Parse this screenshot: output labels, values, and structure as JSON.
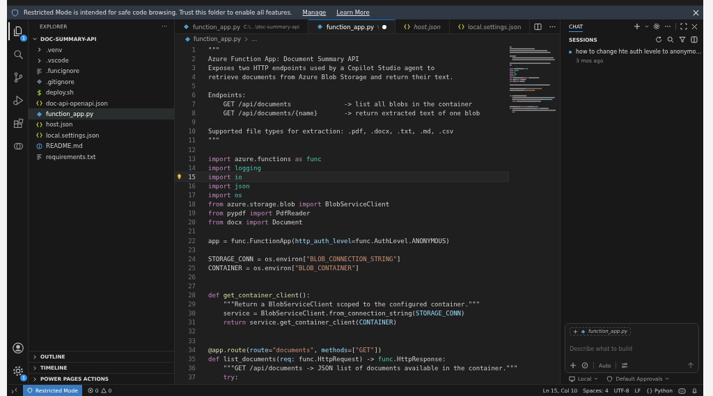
{
  "banner": {
    "message": "Restricted Mode is intended for safe code browsing. Trust this folder to enable all features.",
    "links": [
      "Manage",
      "Learn More"
    ]
  },
  "activity_bar": {
    "top": [
      {
        "kind": "files",
        "selected": true,
        "badge": "1"
      },
      {
        "kind": "search",
        "selected": false
      },
      {
        "kind": "source-control",
        "selected": false
      },
      {
        "kind": "run",
        "selected": false
      },
      {
        "kind": "extensions",
        "selected": false
      },
      {
        "kind": "copilot",
        "selected": false
      }
    ],
    "bottom": [
      {
        "kind": "account",
        "selected": false
      },
      {
        "kind": "settings",
        "selected": false,
        "badge": "1"
      }
    ]
  },
  "sidebar": {
    "title": "EXPLORER",
    "more": "···",
    "root": {
      "label": "DOC-SUMMARY-API",
      "expanded": true,
      "children": [
        {
          "label": ".venv",
          "kind": "folder",
          "expanded": false,
          "selected": false
        },
        {
          "label": ".vscode",
          "kind": "folder",
          "expanded": false,
          "selected": false
        },
        {
          "label": ".funcignore",
          "kind": "lines",
          "selected": false
        },
        {
          "label": ".gitignore",
          "kind": "git",
          "selected": false
        },
        {
          "label": "deploy.sh",
          "kind": "shell",
          "selected": false
        },
        {
          "label": "doc-api-openapi.json",
          "kind": "json",
          "selected": false
        },
        {
          "label": "function_app.py",
          "kind": "python",
          "selected": true
        },
        {
          "label": "host.json",
          "kind": "json",
          "selected": false
        },
        {
          "label": "local.settings.json",
          "kind": "json",
          "selected": false
        },
        {
          "label": "README.md",
          "kind": "info",
          "selected": false
        },
        {
          "label": "requirements.txt",
          "kind": "lines",
          "selected": false
        }
      ]
    },
    "sections": [
      {
        "label": "OUTLINE",
        "expanded": false
      },
      {
        "label": "TIMELINE",
        "expanded": false
      },
      {
        "label": "POWER PAGES ACTIONS",
        "expanded": false
      }
    ]
  },
  "tabs": [
    {
      "label": "function_app.py",
      "kind": "python",
      "description": "C:\\...\\doc-summary-api",
      "selected": false,
      "preview": false,
      "dirty": false
    },
    {
      "label": "function_app.py",
      "kind": "python",
      "description": "\\",
      "selected": true,
      "preview": false,
      "dirty": true
    },
    {
      "label": "host.json",
      "kind": "json",
      "selected": false,
      "preview": true,
      "dirty": false
    },
    {
      "label": "local.settings.json",
      "kind": "json",
      "selected": false,
      "preview": false,
      "dirty": false
    }
  ],
  "breadcrumb": [
    "function_app.py",
    "..."
  ],
  "code": [
    {
      "number": "1",
      "active": false,
      "tokens": [
        {
          "text": "\"\"\"",
          "kind": "doc"
        }
      ]
    },
    {
      "number": "2",
      "active": false,
      "tokens": [
        {
          "text": "Azure Function App: Document Summary API",
          "kind": "doc"
        }
      ]
    },
    {
      "number": "3",
      "active": false,
      "tokens": [
        {
          "text": "Exposes two HTTP endpoints used by a Copilot Studio agent to",
          "kind": "doc"
        }
      ]
    },
    {
      "number": "4",
      "active": false,
      "tokens": [
        {
          "text": "retrieve documents from Azure Blob Storage and return their text.",
          "kind": "doc"
        }
      ]
    },
    {
      "number": "5",
      "active": false
    },
    {
      "number": "6",
      "active": false,
      "tokens": [
        {
          "text": "Endpoints:",
          "kind": "doc"
        }
      ]
    },
    {
      "number": "7",
      "active": false,
      "tokens": [
        {
          "text": "    GET /api/documents              -> list all blobs in the container",
          "kind": "doc"
        }
      ]
    },
    {
      "number": "8",
      "active": false,
      "tokens": [
        {
          "text": "    GET /api/documents/{name}       -> return extracted text of one blob",
          "kind": "doc"
        }
      ]
    },
    {
      "number": "9",
      "active": false
    },
    {
      "number": "10",
      "active": false,
      "tokens": [
        {
          "text": "Supported file types for extraction: .pdf, .docx, .txt, .md, .csv",
          "kind": "doc"
        }
      ]
    },
    {
      "number": "11",
      "active": false,
      "tokens": [
        {
          "text": "\"\"\"",
          "kind": "doc"
        }
      ]
    },
    {
      "number": "12",
      "active": false
    },
    {
      "number": "13",
      "active": false,
      "tokens": [
        {
          "text": "import",
          "kind": "kw"
        },
        {
          "text": " azure.functions ",
          "kind": "op"
        },
        {
          "text": "as",
          "kind": "kw"
        },
        {
          "text": " func",
          "kind": "cls"
        }
      ]
    },
    {
      "number": "14",
      "active": false,
      "tokens": [
        {
          "text": "import",
          "kind": "kw"
        },
        {
          "text": " logging",
          "kind": "cls"
        }
      ]
    },
    {
      "number": "15",
      "active": true,
      "tokens": [
        {
          "text": "import",
          "kind": "kw"
        },
        {
          "text": " io",
          "kind": "cls"
        }
      ]
    },
    {
      "number": "16",
      "active": false,
      "tokens": [
        {
          "text": "import",
          "kind": "kw"
        },
        {
          "text": " json",
          "kind": "cls"
        }
      ]
    },
    {
      "number": "17",
      "active": false,
      "tokens": [
        {
          "text": "import",
          "kind": "kw"
        },
        {
          "text": " os",
          "kind": "cls"
        }
      ]
    },
    {
      "number": "18",
      "active": false,
      "tokens": [
        {
          "text": "from",
          "kind": "kw"
        },
        {
          "text": " azure.storage.blob ",
          "kind": "op"
        },
        {
          "text": "import",
          "kind": "kw"
        },
        {
          "text": " BlobServiceClient",
          "kind": "op"
        }
      ]
    },
    {
      "number": "19",
      "active": false,
      "tokens": [
        {
          "text": "from",
          "kind": "kw"
        },
        {
          "text": " pypdf ",
          "kind": "op"
        },
        {
          "text": "import",
          "kind": "kw"
        },
        {
          "text": " PdfReader",
          "kind": "op"
        }
      ]
    },
    {
      "number": "20",
      "active": false,
      "tokens": [
        {
          "text": "from",
          "kind": "kw"
        },
        {
          "text": " docx ",
          "kind": "op"
        },
        {
          "text": "import",
          "kind": "kw"
        },
        {
          "text": " Document",
          "kind": "op"
        }
      ]
    },
    {
      "number": "21",
      "active": false
    },
    {
      "number": "22",
      "active": false,
      "tokens": [
        {
          "text": "app = func.FunctionApp(",
          "kind": "op"
        },
        {
          "text": "http_auth_level",
          "kind": "var"
        },
        {
          "text": "=func.AuthLevel.ANONYMOUS)",
          "kind": "op"
        }
      ]
    },
    {
      "number": "23",
      "active": false
    },
    {
      "number": "24",
      "active": false,
      "tokens": [
        {
          "text": "STORAGE_CONN = os.environ[",
          "kind": "op"
        },
        {
          "text": "\"BLOB_CONNECTION_STRING\"",
          "kind": "str"
        },
        {
          "text": "]",
          "kind": "op"
        }
      ]
    },
    {
      "number": "25",
      "active": false,
      "tokens": [
        {
          "text": "CONTAINER = os.environ[",
          "kind": "op"
        },
        {
          "text": "\"BLOB_CONTAINER\"",
          "kind": "str"
        },
        {
          "text": "]",
          "kind": "op"
        }
      ]
    },
    {
      "number": "26",
      "active": false
    },
    {
      "number": "27",
      "active": false
    },
    {
      "number": "28",
      "active": false,
      "tokens": [
        {
          "text": "def",
          "kind": "kw"
        },
        {
          "text": " get_container_client",
          "kind": "fn"
        },
        {
          "text": "():",
          "kind": "op"
        }
      ]
    },
    {
      "number": "29",
      "active": false,
      "tokens": [
        {
          "text": "    \"\"\"Return a BlobServiceClient scoped to the configured container.\"\"\"",
          "kind": "doc"
        }
      ]
    },
    {
      "number": "30",
      "active": false,
      "tokens": [
        {
          "text": "    service = BlobServiceClient.from_connection_string(",
          "kind": "op"
        },
        {
          "text": "STORAGE_CONN",
          "kind": "var"
        },
        {
          "text": ")",
          "kind": "op"
        }
      ]
    },
    {
      "number": "31",
      "active": false,
      "tokens": [
        {
          "text": "    return",
          "kind": "kw"
        },
        {
          "text": " service.get_container_client(",
          "kind": "op"
        },
        {
          "text": "CONTAINER",
          "kind": "var"
        },
        {
          "text": ")",
          "kind": "op"
        }
      ]
    },
    {
      "number": "32",
      "active": false
    },
    {
      "number": "33",
      "active": false
    },
    {
      "number": "34",
      "active": false,
      "tokens": [
        {
          "text": "@app.route(",
          "kind": "fn"
        },
        {
          "text": "route",
          "kind": "var"
        },
        {
          "text": "=",
          "kind": "op"
        },
        {
          "text": "\"documents\"",
          "kind": "str"
        },
        {
          "text": ", ",
          "kind": "op"
        },
        {
          "text": "methods",
          "kind": "var"
        },
        {
          "text": "=[",
          "kind": "op"
        },
        {
          "text": "\"GET\"",
          "kind": "str"
        },
        {
          "text": "])",
          "kind": "fn"
        }
      ]
    },
    {
      "number": "35",
      "active": false,
      "tokens": [
        {
          "text": "def",
          "kind": "kw"
        },
        {
          "text": " list_documents(",
          "kind": "op"
        },
        {
          "text": "req",
          "kind": "var"
        },
        {
          "text": ": func.HttpRequest) -> ",
          "kind": "op"
        },
        {
          "text": "func",
          "kind": "cls"
        },
        {
          "text": ".HttpResponse:",
          "kind": "op"
        }
      ]
    },
    {
      "number": "36",
      "active": false,
      "tokens": [
        {
          "text": "    \"\"\"GET /api/documents -> JSON list of documents available in the container.\"\"\"",
          "kind": "doc"
        }
      ]
    },
    {
      "number": "37",
      "active": false,
      "tokens": [
        {
          "text": "    try",
          "kind": "kw"
        },
        {
          "text": ":",
          "kind": "op"
        }
      ]
    }
  ],
  "chat": {
    "tab": "CHAT",
    "sessions_title": "SESSIONS",
    "sessions": [
      {
        "title": "how to change hte auth levele to anonymo…",
        "time": "3 mos ago",
        "unread": true
      }
    ],
    "attachment": "function_app.py",
    "placeholder": "Describe what to build",
    "mode": "Auto",
    "footer": [
      "Local",
      "Default Approvals"
    ]
  },
  "status_bar": {
    "mode": "Restricted Mode",
    "errors": "0",
    "warnings": "0",
    "items": [
      "Ln 15, Col 10",
      "Spaces: 4",
      "UTF-8",
      "LF",
      "{} Python"
    ]
  }
}
